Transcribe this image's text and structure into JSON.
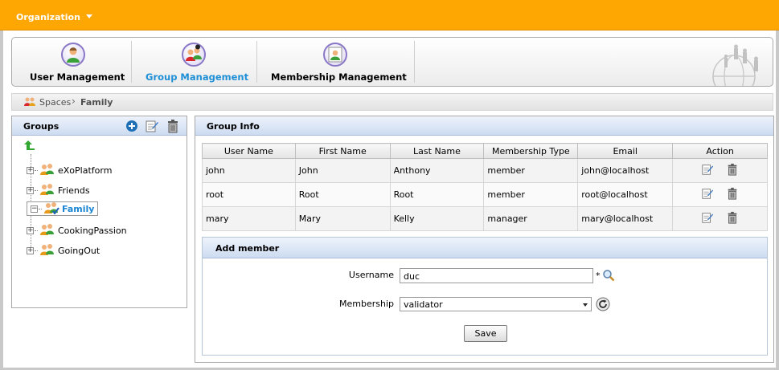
{
  "topbar": {
    "title": "Organization"
  },
  "tabs": [
    {
      "label": "User Management",
      "icon": "user-management-icon"
    },
    {
      "label": "Group Management",
      "icon": "group-management-icon"
    },
    {
      "label": "Membership Management",
      "icon": "membership-management-icon"
    }
  ],
  "active_tab": "Group Management",
  "breadcrumb": {
    "root": "Spaces",
    "current": "Family"
  },
  "groups": {
    "title": "Groups",
    "nodes": [
      {
        "label": "eXoPlatform"
      },
      {
        "label": "Friends"
      },
      {
        "label": "Family"
      },
      {
        "label": "CookingPassion"
      },
      {
        "label": "GoingOut"
      }
    ],
    "selected": "Family"
  },
  "group_info": {
    "title": "Group Info",
    "columns": [
      "User Name",
      "First Name",
      "Last Name",
      "Membership Type",
      "Email",
      "Action"
    ],
    "rows": [
      [
        "john",
        "John",
        "Anthony",
        "member",
        "john@localhost"
      ],
      [
        "root",
        "Root",
        "Root",
        "member",
        "root@localhost"
      ],
      [
        "mary",
        "Mary",
        "Kelly",
        "manager",
        "mary@localhost"
      ]
    ]
  },
  "add_member": {
    "title": "Add member",
    "username_label": "Username",
    "username_value": "duc",
    "required_mark": "*",
    "membership_label": "Membership",
    "membership_value": "validator",
    "save_label": "Save"
  },
  "colors": {
    "topbar": "#fea601",
    "active_tab": "#1f8fd6",
    "panel_header": "#cddcf1"
  }
}
